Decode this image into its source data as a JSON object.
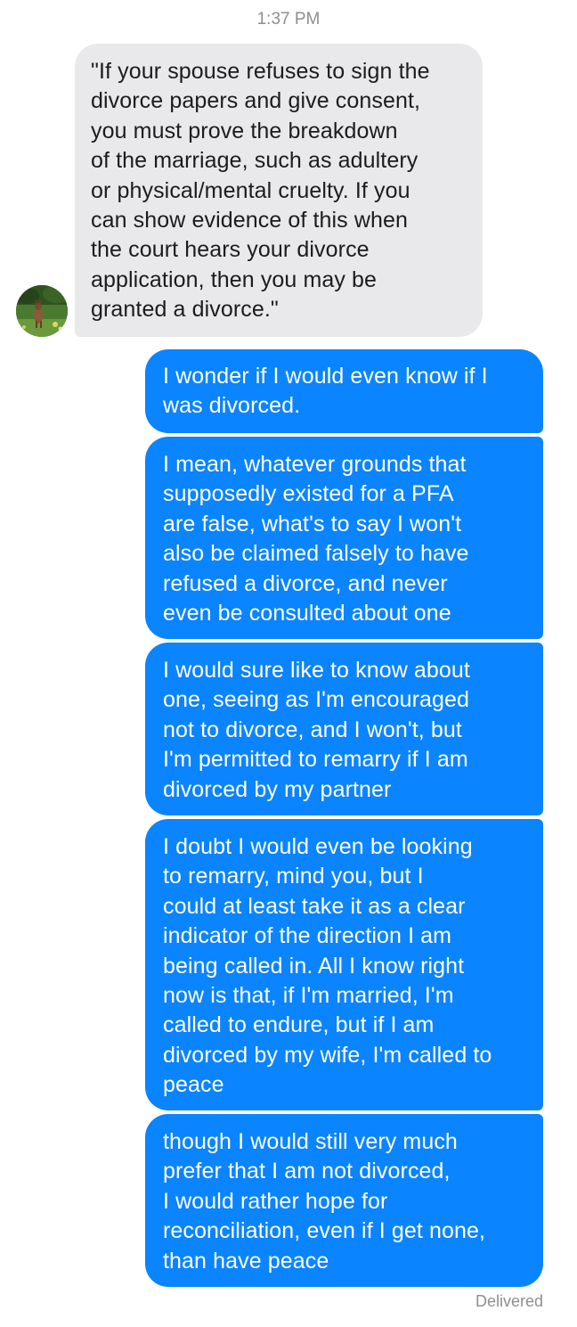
{
  "header": {
    "timestamp": "1:37 PM"
  },
  "contact": {
    "avatar_icon": "avatar-photo-icon"
  },
  "messages": [
    {
      "direction": "incoming",
      "text": "\"If your spouse refuses to sign the\ndivorce papers and give consent,\nyou must prove the breakdown\nof the marriage, such as adultery\nor physical/mental cruelty. If you\ncan show evidence of this when\nthe court hears your divorce\napplication, then you may be\ngranted a divorce.\""
    },
    {
      "direction": "outgoing",
      "text": "I wonder if I would even know if I\nwas divorced."
    },
    {
      "direction": "outgoing",
      "text": "I mean, whatever grounds that\nsupposedly existed for a PFA\nare false, what's to say I won't\nalso be claimed falsely to have\nrefused a divorce, and never\neven be consulted about one"
    },
    {
      "direction": "outgoing",
      "text": "I would sure like to know about\none, seeing as I'm encouraged\nnot to divorce, and I won't, but\nI'm permitted to remarry if I am\ndivorced by my partner"
    },
    {
      "direction": "outgoing",
      "text": "I doubt I would even be looking\nto remarry, mind you, but I\ncould at least take it as a clear\nindicator of the direction I am\nbeing called in. All I know right\nnow is that, if I'm married, I'm\ncalled to endure, but if I am\ndivorced by my wife, I'm called to\npeace"
    },
    {
      "direction": "outgoing",
      "text": "though I would still very much\nprefer that I am not divorced,\nI would rather hope for\nreconciliation, even if I get none,\nthan have peace"
    }
  ],
  "footer": {
    "status": "Delivered"
  },
  "colors": {
    "incoming_bubble": "#e9e9eb",
    "outgoing_bubble": "#0a84ff",
    "meta_text": "#8e8e93"
  }
}
